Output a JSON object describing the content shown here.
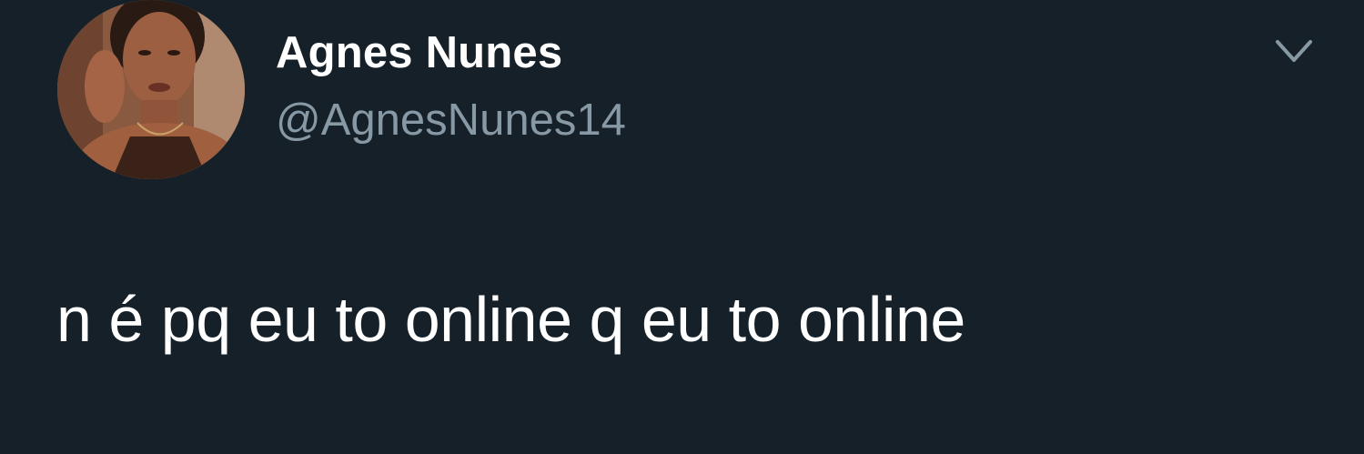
{
  "author": {
    "display_name": "Agnes Nunes",
    "handle": "@AgnesNunes14",
    "avatar_icon": "profile-photo"
  },
  "tweet": {
    "text": "n é pq eu to online q eu to online"
  },
  "menu": {
    "icon": "chevron-down-icon"
  },
  "colors": {
    "background": "#162029",
    "name": "#ffffff",
    "handle": "#8899a6",
    "text": "#ffffff",
    "chevron": "#8899a6"
  }
}
